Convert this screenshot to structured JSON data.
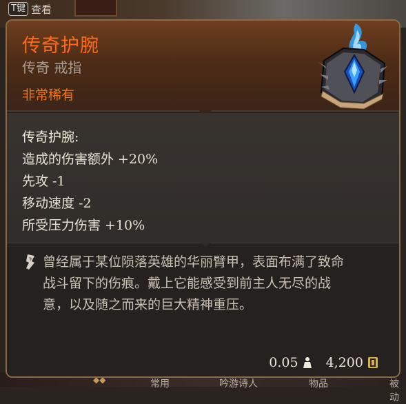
{
  "hud": {
    "key_label": "T键",
    "inspect_label": "查看",
    "bottom_tabs": [
      "常用",
      "吟游诗人",
      "物品",
      "被动"
    ]
  },
  "item": {
    "name": "传奇护腕",
    "type": "传奇 戒指",
    "rarity": "非常稀有",
    "icon": "bracer-blue-gem-icon",
    "stats_title": "传奇护腕:",
    "stats": [
      "造成的伤害额外 +20%",
      "先攻 -1",
      "移动速度 -2",
      "所受压力伤害 +10%"
    ],
    "description_icon": "quill-icon",
    "description_lines": [
      "曾经属于某位陨落英雄的华丽臂甲，表面布满了致命",
      "战斗留下的伤痕。戴上它能感受到前主人无尽的战",
      "意，以及随之而来的巨大精神重压。"
    ],
    "weight": "0.05",
    "weight_icon": "weight-icon",
    "price": "4,200",
    "price_icon": "gold-icon"
  },
  "colors": {
    "name": "#ff6a1a",
    "rarity": "#f0741a",
    "type": "#a89f94",
    "stats": "#e9e2d6",
    "description": "#c9c1b5",
    "border": "#8a6a4a"
  }
}
